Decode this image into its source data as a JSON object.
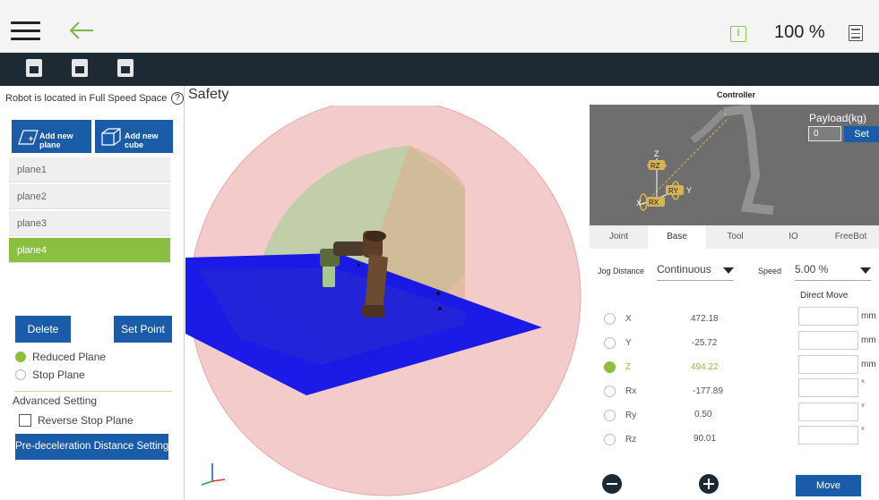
{
  "header": {
    "speed_percent": "100 %",
    "icons": [
      "menu-icon",
      "back-arrow-icon",
      "info-icon",
      "log-icon"
    ],
    "accent_color": "#8cbf3f",
    "primary_color": "#1a5ca8",
    "toolbar_color": "#1e2a33"
  },
  "left": {
    "space_status": "Robot is located in Full Speed Space",
    "add_plane_label": "Add new plane",
    "add_cube_label": "Add new cube",
    "planes": [
      "plane1",
      "plane2",
      "plane3",
      "plane4"
    ],
    "selected_plane": "plane4",
    "delete_label": "Delete",
    "set_point_label": "Set Point",
    "reduced_plane_label": "Reduced Plane",
    "stop_plane_label": "Stop Plane",
    "advanced_label": "Advanced Setting",
    "reverse_stop_label": "Reverse Stop Plane",
    "predecel_label": "Pre-deceleration Distance Setting"
  },
  "viewport": {
    "title": "Safety"
  },
  "controller": {
    "title": "Controller",
    "payload_label": "Payload(kg)",
    "payload_value": "0",
    "set_label": "Set",
    "axis_labels": {
      "z": "Z",
      "rz": "RZ",
      "ry": "RY",
      "y": "Y",
      "x": "X",
      "rx": "RX"
    },
    "tabs": [
      "Joint",
      "Base",
      "Tool",
      "IO",
      "FreeBot"
    ],
    "active_tab": "Base",
    "jog_distance_label": "Jog Distance",
    "jog_distance_value": "Continuous",
    "speed_label": "Speed",
    "speed_value": "5.00 %",
    "direct_move_label": "Direct Move",
    "coords": [
      {
        "name": "X",
        "value": "472.18",
        "unit": "mm"
      },
      {
        "name": "Y",
        "value": "-25.72",
        "unit": "mm"
      },
      {
        "name": "Z",
        "value": "494.22",
        "unit": "mm"
      },
      {
        "name": "Rx",
        "value": "-177.89",
        "unit": "°"
      },
      {
        "name": "Ry",
        "value": "0.50",
        "unit": "°"
      },
      {
        "name": "Rz",
        "value": "90.01",
        "unit": "°"
      }
    ],
    "selected_coord": "Z",
    "move_label": "Move"
  }
}
